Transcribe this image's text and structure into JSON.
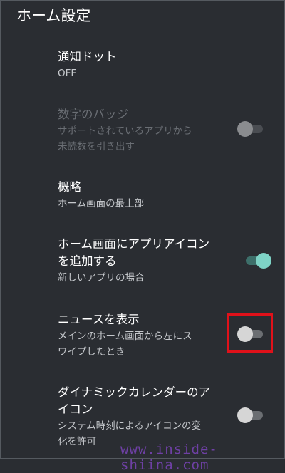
{
  "header": {
    "title": "ホーム設定"
  },
  "settings": [
    {
      "title": "通知ドット",
      "subtitle": "OFF"
    },
    {
      "title": "数字のバッジ",
      "subtitle_line1": "サポートされているアプリから",
      "subtitle_line2": "未読数を引き出す",
      "toggle": "off",
      "enabled": false
    },
    {
      "title": "概略",
      "subtitle": "ホーム画面の最上部"
    },
    {
      "title_line1": "ホーム画面にアプリアイコン",
      "title_line2": "を追加する",
      "subtitle": "新しいアプリの場合",
      "toggle": "on"
    },
    {
      "title": "ニュースを表示",
      "subtitle_line1": "メインのホーム画面から左にス",
      "subtitle_line2": "ワイプしたとき",
      "toggle": "off"
    },
    {
      "title_line1": "ダイナミックカレンダーのア",
      "title_line2": "イコン",
      "subtitle_line1": "システム時刻によるアイコンの変",
      "subtitle_line2": "化を許可",
      "toggle": "off"
    }
  ],
  "annotation": {
    "highlight_color": "#e0111a"
  },
  "watermark": "www.inside-shiina.com",
  "colors": {
    "background": "#2a2d32",
    "accent": "#7ed3c6"
  }
}
